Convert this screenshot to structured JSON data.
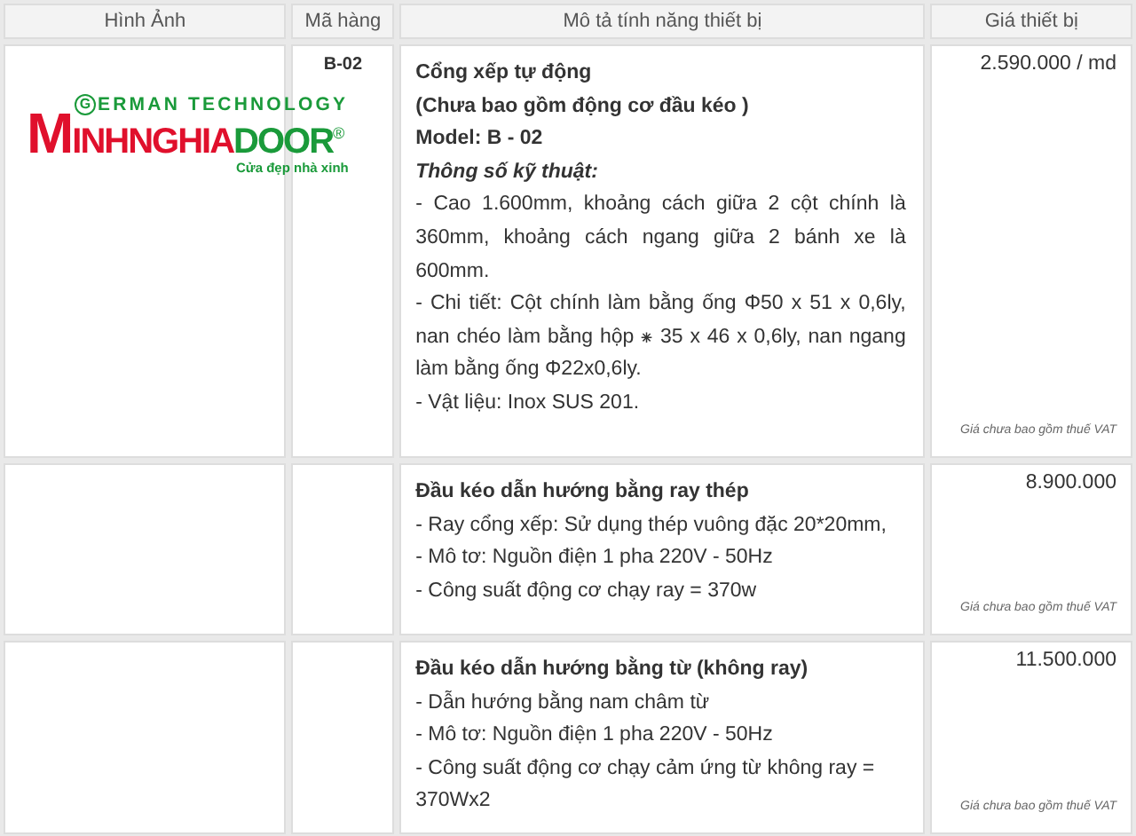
{
  "table": {
    "columns": [
      "Hình Ảnh",
      "Mã hàng",
      "Mô tả tính năng thiết bị",
      "Giá thiết bị"
    ],
    "rows": [
      {
        "logo": {
          "initial": "G",
          "top": "ERMAN TECHNOLOGY",
          "red": "MINHNGHIA",
          "green": "DOOR",
          "mark": "®",
          "tagline": "Cửa đẹp nhà xinh"
        },
        "code": "B-02",
        "price": "2.590.000 / md",
        "note": "Giá chưa bao gồm thuế VAT",
        "lines": [
          {
            "kind": "bold",
            "text": "Cổng xếp tự động"
          },
          {
            "kind": "bold",
            "text": "(Chưa bao gồm động cơ đầu kéo )"
          },
          {
            "kind": "bold",
            "text": "Model: B - 02"
          },
          {
            "kind": "heading",
            "text": "Thông số kỹ thuật:"
          },
          {
            "kind": "justify",
            "text": "- Cao 1.600mm, khoảng cách giữa 2 cột chính là 360mm, khoảng cách ngang giữa 2 bánh xe là 600mm."
          },
          {
            "kind": "justify",
            "text": "- Chi tiết: Cột chính làm bằng ống Φ50 x 51 x 0,6ly, nan chéo làm bằng hộp  ⁕ 35 x 46 x 0,6ly, nan ngang làm bằng ống Φ22x0,6ly."
          },
          {
            "kind": "text",
            "text": "- Vật liệu:  Inox SUS 201."
          }
        ]
      },
      {
        "price": "8.900.000",
        "note": "Giá chưa bao gồm thuế VAT",
        "lines": [
          {
            "kind": "bold",
            "text": "Đầu kéo dẫn hướng bằng ray thép"
          },
          {
            "kind": "text",
            "text": "- Ray cổng xếp: Sử dụng thép vuông đặc 20*20mm,"
          },
          {
            "kind": "text",
            "text": "- Mô tơ: Nguồn điện 1 pha 220V - 50Hz"
          },
          {
            "kind": "text",
            "text": "- Công suất động cơ chạy ray = 370w"
          }
        ]
      },
      {
        "price": "11.500.000",
        "note": "Giá chưa bao gồm thuế VAT",
        "lines": [
          {
            "kind": "bold",
            "text": "Đầu kéo dẫn hướng bằng từ (không ray)"
          },
          {
            "kind": "text",
            "text": "- Dẫn hướng bằng nam châm từ"
          },
          {
            "kind": "text",
            "text": "- Mô tơ: Nguồn điện 1 pha 220V - 50Hz"
          },
          {
            "kind": "text",
            "text": "- Công suất động cơ chạy cảm ứng từ không ray = 370Wx2"
          }
        ]
      }
    ]
  }
}
